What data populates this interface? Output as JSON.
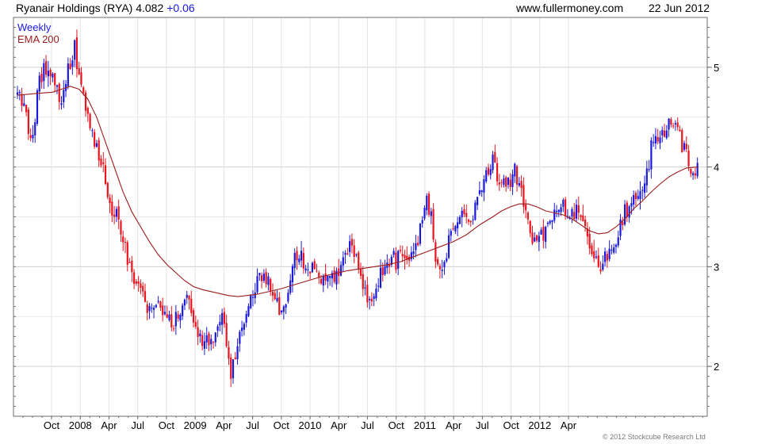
{
  "header": {
    "title": "Ryanair Holdings (RYA) 4.082",
    "change": "+0.06",
    "site": "www.fullermoney.com",
    "date": "22 Jun 2012"
  },
  "footer": {
    "copyright": "© 2012 Stockcube Research Ltd"
  },
  "colors": {
    "up": "#1a1adc",
    "down": "#e8141e",
    "ema": "#9b1b1b",
    "grid": "#dcdcdc",
    "frame": "#6e6e6e"
  },
  "chart_data": {
    "type": "candlestick",
    "title": "Ryanair Holdings (RYA) 4.082 +0.06",
    "legend": [
      {
        "label": "Weekly",
        "color": "#1a1adc"
      },
      {
        "label": "EMA 200",
        "color": "#9b1b1b"
      }
    ],
    "legend_position": "top-left",
    "y_axis": {
      "side": "right",
      "ticks": [
        2,
        3,
        4,
        5
      ],
      "range": [
        1.5,
        5.5
      ]
    },
    "x_axis": {
      "ticks": [
        "Oct",
        "2008",
        "Apr",
        "Jul",
        "Oct",
        "2009",
        "Apr",
        "Jul",
        "Oct",
        "2010",
        "Apr",
        "Jul",
        "Oct",
        "2011",
        "Apr",
        "Jul",
        "Oct",
        "2012",
        "Apr"
      ]
    },
    "grid": true,
    "series": [
      {
        "name": "Weekly",
        "kind": "close",
        "points": [
          [
            0,
            4.75
          ],
          [
            3,
            4.6
          ],
          [
            6,
            4.3
          ],
          [
            8,
            4.5
          ],
          [
            10,
            4.9
          ],
          [
            13,
            5.0
          ],
          [
            15,
            4.9
          ],
          [
            17,
            4.8
          ],
          [
            20,
            4.6
          ],
          [
            22,
            4.9
          ],
          [
            24,
            5.0
          ],
          [
            26,
            5.2
          ],
          [
            28,
            4.9
          ],
          [
            30,
            4.7
          ],
          [
            32,
            4.5
          ],
          [
            34,
            4.3
          ],
          [
            36,
            4.2
          ],
          [
            38,
            4.1
          ],
          [
            40,
            3.9
          ],
          [
            42,
            3.6
          ],
          [
            45,
            3.5
          ],
          [
            47,
            3.3
          ],
          [
            50,
            3.1
          ],
          [
            52,
            2.95
          ],
          [
            54,
            2.8
          ],
          [
            57,
            2.75
          ],
          [
            59,
            2.6
          ],
          [
            61,
            2.55
          ],
          [
            63,
            2.55
          ],
          [
            65,
            2.6
          ],
          [
            67,
            2.55
          ],
          [
            69,
            2.5
          ],
          [
            71,
            2.45
          ],
          [
            73,
            2.5
          ],
          [
            75,
            2.6
          ],
          [
            77,
            2.8
          ],
          [
            78,
            2.7
          ],
          [
            80,
            2.5
          ],
          [
            82,
            2.3
          ],
          [
            84,
            2.25
          ],
          [
            86,
            2.3
          ],
          [
            88,
            2.25
          ],
          [
            90,
            2.4
          ],
          [
            92,
            2.5
          ],
          [
            94,
            2.4
          ],
          [
            96,
            2.0
          ],
          [
            97,
            1.8
          ],
          [
            98,
            2.0
          ],
          [
            100,
            2.2
          ],
          [
            102,
            2.4
          ],
          [
            104,
            2.6
          ],
          [
            106,
            2.75
          ],
          [
            108,
            2.8
          ],
          [
            110,
            2.85
          ],
          [
            112,
            2.95
          ],
          [
            114,
            2.85
          ],
          [
            116,
            2.7
          ],
          [
            118,
            2.6
          ],
          [
            120,
            2.6
          ],
          [
            122,
            2.7
          ],
          [
            124,
            2.85
          ],
          [
            126,
            3.05
          ],
          [
            128,
            3.15
          ],
          [
            130,
            3.05
          ],
          [
            132,
            2.95
          ],
          [
            134,
            3.0
          ],
          [
            136,
            2.9
          ],
          [
            138,
            2.9
          ],
          [
            140,
            2.85
          ],
          [
            142,
            2.9
          ],
          [
            144,
            2.85
          ],
          [
            146,
            2.95
          ],
          [
            148,
            3.05
          ],
          [
            150,
            3.15
          ],
          [
            152,
            3.2
          ],
          [
            154,
            3.1
          ],
          [
            156,
            2.95
          ],
          [
            158,
            2.75
          ],
          [
            160,
            2.6
          ],
          [
            162,
            2.65
          ],
          [
            164,
            2.8
          ],
          [
            166,
            3.0
          ],
          [
            168,
            3.05
          ],
          [
            170,
            3.1
          ],
          [
            172,
            3.05
          ],
          [
            174,
            3.1
          ],
          [
            176,
            3.1
          ],
          [
            178,
            3.15
          ],
          [
            180,
            3.2
          ],
          [
            182,
            3.3
          ],
          [
            184,
            3.5
          ],
          [
            186,
            3.65
          ],
          [
            188,
            3.55
          ],
          [
            190,
            3.1
          ],
          [
            192,
            2.95
          ],
          [
            194,
            3.0
          ],
          [
            196,
            3.25
          ],
          [
            198,
            3.35
          ],
          [
            200,
            3.5
          ],
          [
            202,
            3.6
          ],
          [
            204,
            3.5
          ],
          [
            206,
            3.45
          ],
          [
            208,
            3.6
          ],
          [
            210,
            3.7
          ],
          [
            212,
            3.85
          ],
          [
            214,
            4.0
          ],
          [
            216,
            4.1
          ],
          [
            218,
            3.85
          ],
          [
            220,
            3.9
          ],
          [
            222,
            3.85
          ],
          [
            224,
            3.8
          ],
          [
            226,
            3.95
          ],
          [
            228,
            3.85
          ],
          [
            230,
            3.6
          ],
          [
            232,
            3.5
          ],
          [
            234,
            3.3
          ],
          [
            236,
            3.25
          ],
          [
            238,
            3.3
          ],
          [
            240,
            3.35
          ],
          [
            242,
            3.45
          ],
          [
            244,
            3.55
          ],
          [
            246,
            3.5
          ],
          [
            248,
            3.6
          ],
          [
            250,
            3.55
          ],
          [
            252,
            3.5
          ],
          [
            254,
            3.6
          ],
          [
            256,
            3.55
          ],
          [
            258,
            3.35
          ],
          [
            260,
            3.15
          ],
          [
            262,
            3.05
          ],
          [
            264,
            3.0
          ],
          [
            266,
            3.05
          ],
          [
            268,
            3.1
          ],
          [
            270,
            3.2
          ],
          [
            272,
            3.3
          ],
          [
            274,
            3.45
          ],
          [
            276,
            3.55
          ],
          [
            278,
            3.6
          ],
          [
            280,
            3.7
          ],
          [
            282,
            3.75
          ],
          [
            284,
            3.8
          ],
          [
            286,
            3.9
          ],
          [
            288,
            4.2
          ],
          [
            290,
            4.3
          ],
          [
            292,
            4.35
          ],
          [
            294,
            4.3
          ],
          [
            296,
            4.4
          ],
          [
            298,
            4.45
          ],
          [
            300,
            4.4
          ],
          [
            302,
            4.2
          ],
          [
            304,
            4.15
          ],
          [
            306,
            4.0
          ],
          [
            307,
            3.9
          ],
          [
            308,
            4.0
          ],
          [
            309,
            4.08
          ]
        ]
      },
      {
        "name": "EMA 200",
        "kind": "line",
        "points": [
          [
            0,
            4.72
          ],
          [
            10,
            4.74
          ],
          [
            16,
            4.75
          ],
          [
            20,
            4.78
          ],
          [
            24,
            4.81
          ],
          [
            28,
            4.78
          ],
          [
            32,
            4.68
          ],
          [
            36,
            4.5
          ],
          [
            40,
            4.25
          ],
          [
            44,
            4.0
          ],
          [
            48,
            3.75
          ],
          [
            52,
            3.55
          ],
          [
            56,
            3.4
          ],
          [
            60,
            3.25
          ],
          [
            64,
            3.12
          ],
          [
            68,
            3.02
          ],
          [
            72,
            2.94
          ],
          [
            76,
            2.86
          ],
          [
            80,
            2.8
          ],
          [
            84,
            2.77
          ],
          [
            88,
            2.75
          ],
          [
            92,
            2.73
          ],
          [
            96,
            2.71
          ],
          [
            100,
            2.7
          ],
          [
            104,
            2.71
          ],
          [
            108,
            2.72
          ],
          [
            112,
            2.74
          ],
          [
            116,
            2.76
          ],
          [
            120,
            2.78
          ],
          [
            126,
            2.82
          ],
          [
            132,
            2.86
          ],
          [
            138,
            2.9
          ],
          [
            144,
            2.93
          ],
          [
            150,
            2.96
          ],
          [
            156,
            2.98
          ],
          [
            162,
            3.0
          ],
          [
            168,
            3.02
          ],
          [
            174,
            3.05
          ],
          [
            180,
            3.1
          ],
          [
            186,
            3.15
          ],
          [
            192,
            3.2
          ],
          [
            198,
            3.25
          ],
          [
            204,
            3.32
          ],
          [
            210,
            3.42
          ],
          [
            216,
            3.5
          ],
          [
            220,
            3.56
          ],
          [
            224,
            3.6
          ],
          [
            228,
            3.63
          ],
          [
            232,
            3.63
          ],
          [
            236,
            3.6
          ],
          [
            240,
            3.56
          ],
          [
            244,
            3.54
          ],
          [
            248,
            3.52
          ],
          [
            252,
            3.48
          ],
          [
            256,
            3.42
          ],
          [
            260,
            3.36
          ],
          [
            264,
            3.33
          ],
          [
            268,
            3.34
          ],
          [
            272,
            3.4
          ],
          [
            276,
            3.48
          ],
          [
            280,
            3.58
          ],
          [
            284,
            3.66
          ],
          [
            288,
            3.75
          ],
          [
            292,
            3.83
          ],
          [
            296,
            3.9
          ],
          [
            300,
            3.95
          ],
          [
            304,
            3.99
          ],
          [
            309,
            4.0
          ]
        ]
      }
    ]
  }
}
